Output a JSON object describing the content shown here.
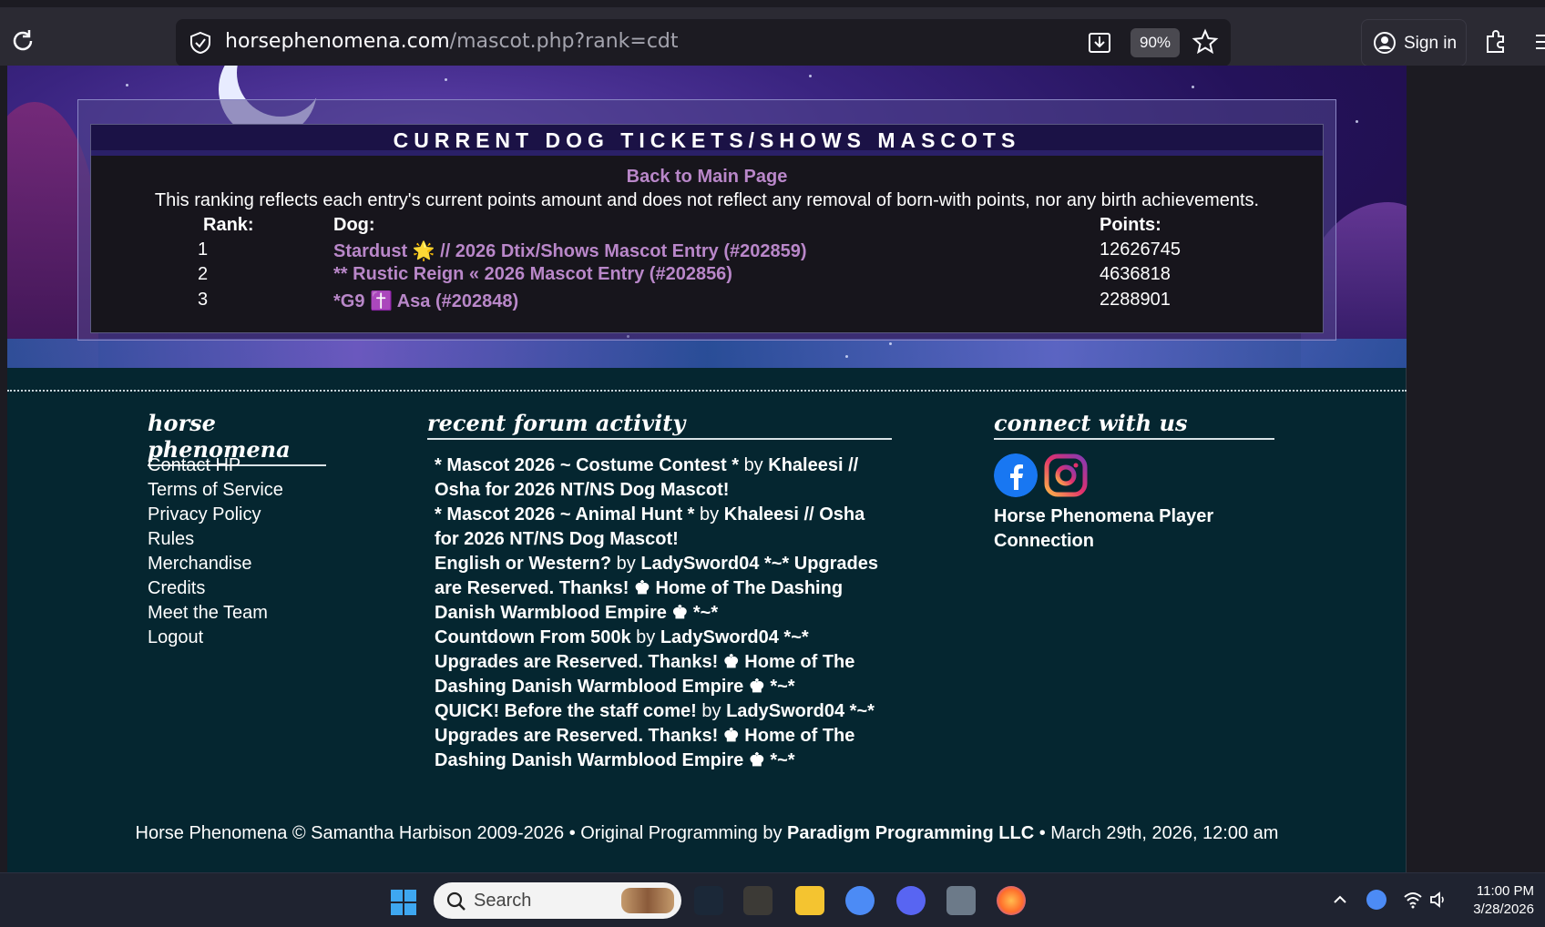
{
  "browser": {
    "url_domain": "horsephenomena.com",
    "url_path": "/mascot.php?rank=cdt",
    "zoom": "90%",
    "sign_in": "Sign in"
  },
  "panel": {
    "title": "CURRENT DOG TICKETS/SHOWS MASCOTS",
    "back_link": "Back to Main Page",
    "description": "This ranking reflects each entry's current points amount and does not reflect any removal of born-with points, nor any birth achievements.",
    "headers": {
      "rank": "Rank:",
      "dog": "Dog:",
      "points": "Points:"
    },
    "rows": [
      {
        "rank": "1",
        "dog": "Stardust 🌟 // 2026 Dtix/Shows Mascot Entry (#202859)",
        "points": "12626745"
      },
      {
        "rank": "2",
        "dog": "** Rustic Reign « 2026 Mascot Entry (#202856)",
        "points": "4636818"
      },
      {
        "rank": "3",
        "dog": "*G9 ✝️ Asa (#202848)",
        "points": "2288901"
      }
    ]
  },
  "footer": {
    "hp_heading": "horse phenomena",
    "hp_links": [
      "Contact HP",
      "Terms of Service",
      "Privacy Policy",
      "Rules",
      "Merchandise",
      "Credits",
      "Meet the Team",
      "Logout"
    ],
    "forum_heading": "recent forum activity",
    "forum_items": [
      {
        "title": "* Mascot 2026 ~ Costume Contest *",
        "by": "by",
        "user": "Khaleesi // Osha for 2026 NT/NS Dog Mascot!"
      },
      {
        "title": "* Mascot 2026 ~ Animal Hunt *",
        "by": "by",
        "user": "Khaleesi // Osha for 2026 NT/NS Dog Mascot!"
      },
      {
        "title": "English or Western?",
        "by": "by",
        "user": "LadySword04 *~* Upgrades are Reserved. Thanks! ♚ Home of The Dashing Danish Warmblood Empire ♚ *~*"
      },
      {
        "title": "Countdown From 500k",
        "by": "by",
        "user": "LadySword04 *~* Upgrades are Reserved. Thanks! ♚ Home of The Dashing Danish Warmblood Empire ♚ *~*"
      },
      {
        "title": "QUICK! Before the staff come!",
        "by": "by",
        "user": "LadySword04 *~* Upgrades are Reserved. Thanks! ♚ Home of The Dashing Danish Warmblood Empire ♚ *~*"
      }
    ],
    "connect_heading": "connect with us",
    "connect_text": "Horse Phenomena Player Connection",
    "copyright_part1": "Horse Phenomena © Samantha Harbison 2009-2026  •  Original Programming by",
    "copyright_company": "Paradigm Programming LLC",
    "copyright_part2": "•  March 29th, 2026, 12:00 am"
  },
  "taskbar": {
    "search_label": "Search",
    "time": "11:00 PM",
    "date": "3/28/2026"
  },
  "colors": {
    "accent_link": "#b987c9",
    "footer_bg": "#052630",
    "panel_bg": "#17151c",
    "header_bg": "#1b1246"
  }
}
